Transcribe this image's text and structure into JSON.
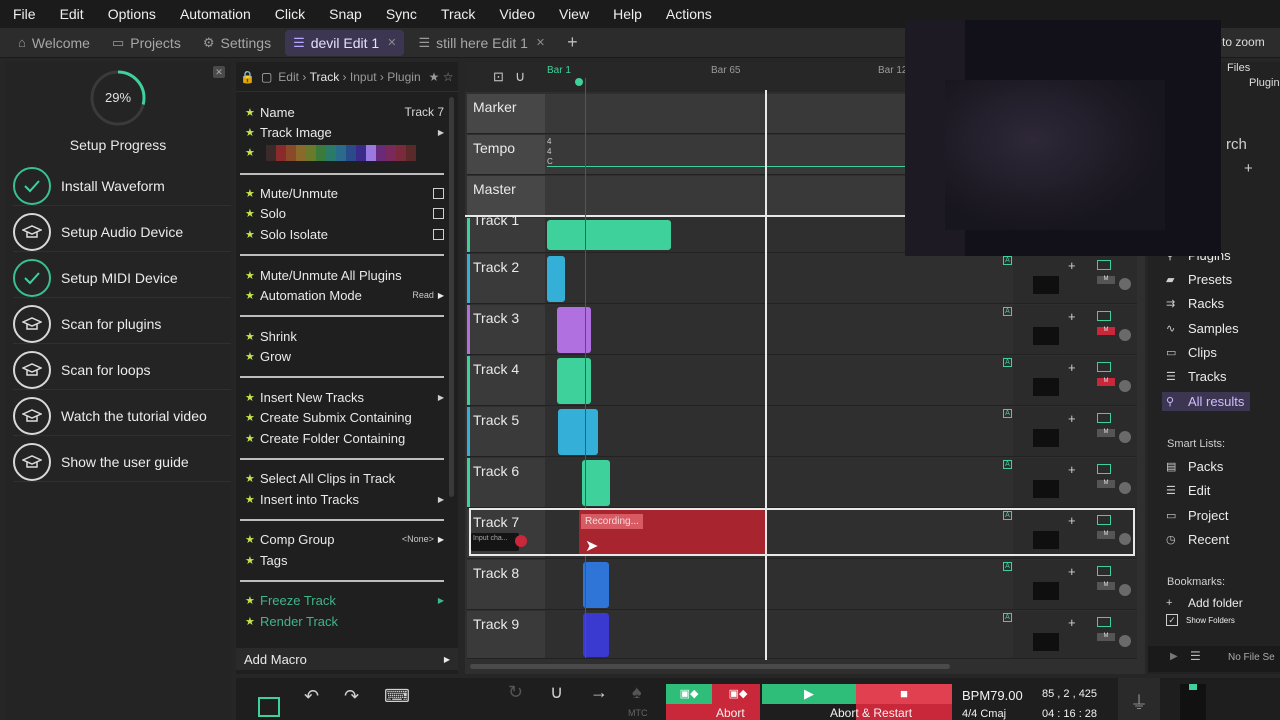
{
  "menu": [
    "File",
    "Edit",
    "Options",
    "Automation",
    "Click",
    "Snap",
    "Sync",
    "Track",
    "Video",
    "View",
    "Help",
    "Actions"
  ],
  "tabs": [
    {
      "label": "Welcome",
      "icon": "home-icon",
      "active": false
    },
    {
      "label": "Projects",
      "icon": "folder-icon",
      "active": false
    },
    {
      "label": "Settings",
      "icon": "gear-icon",
      "active": false
    },
    {
      "label": "devil Edit 1",
      "icon": "edit-icon",
      "active": true
    },
    {
      "label": "still here Edit 1",
      "icon": "edit-icon",
      "active": false
    }
  ],
  "setup": {
    "progress_label": "29%",
    "progress": 0.29,
    "title": "Setup Progress",
    "items": [
      {
        "label": "Install Waveform",
        "done": true
      },
      {
        "label": "Setup Audio Device",
        "done": false
      },
      {
        "label": "Setup MIDI Device",
        "done": true
      },
      {
        "label": "Scan for plugins",
        "done": false
      },
      {
        "label": "Scan for loops",
        "done": false
      },
      {
        "label": "Watch the tutorial video",
        "done": false
      },
      {
        "label": "Show the user guide",
        "done": false
      }
    ]
  },
  "props": {
    "breadcrumb": [
      "Edit",
      "Track",
      "Input",
      "Plugin"
    ],
    "name_label": "Name",
    "name_value": "Track 7",
    "track_image": "Track Image",
    "mute": "Mute/Unmute",
    "solo": "Solo",
    "solo_isolate": "Solo Isolate",
    "mute_all": "Mute/Unmute All Plugins",
    "automation_mode": "Automation Mode",
    "automation_value": "Read",
    "shrink": "Shrink",
    "grow": "Grow",
    "insert_new": "Insert New Tracks",
    "create_submix": "Create Submix Containing",
    "create_folder": "Create Folder Containing",
    "select_all_clips": "Select All Clips in Track",
    "insert_into": "Insert into Tracks",
    "comp_group": "Comp Group",
    "comp_value": "<None>",
    "tags": "Tags",
    "freeze": "Freeze Track",
    "render": "Render Track",
    "add_macro": "Add Macro"
  },
  "timeline": {
    "ruler": [
      "Bar 1",
      "Bar 65",
      "Bar 12"
    ],
    "meta_tracks": [
      "Marker",
      "Tempo",
      "Master"
    ],
    "tempo_sig": [
      "4",
      "4",
      "C"
    ],
    "tracks": [
      {
        "name": "Track 1",
        "color": "#3fd19b"
      },
      {
        "name": "Track 2",
        "color": "#34b0d8"
      },
      {
        "name": "Track 3",
        "color": "#b070e0"
      },
      {
        "name": "Track 4",
        "color": "#3fd19b"
      },
      {
        "name": "Track 5",
        "color": "#34b0d8"
      },
      {
        "name": "Track 6",
        "color": "#3fd19b"
      },
      {
        "name": "Track 7",
        "color": "#b070e0"
      },
      {
        "name": "Track 8",
        "color": "#2f75d8"
      },
      {
        "name": "Track 9",
        "color": "#3a3ad0"
      }
    ],
    "recording_label": "Recording...",
    "input_chip": "Input cha..."
  },
  "topright": {
    "zoom_text": "to zoom",
    "files": "Files",
    "plugin": "Plugin"
  },
  "browser": {
    "search_hint": "rch",
    "items": [
      {
        "label": "Plugins",
        "icon": "plug-icon"
      },
      {
        "label": "Presets",
        "icon": "tag-icon"
      },
      {
        "label": "Racks",
        "icon": "rack-icon"
      },
      {
        "label": "Samples",
        "icon": "wave-icon"
      },
      {
        "label": "Clips",
        "icon": "clips-icon"
      },
      {
        "label": "Tracks",
        "icon": "tracks-icon"
      },
      {
        "label": "All results",
        "icon": "search-icon"
      }
    ],
    "smart_lists_label": "Smart Lists:",
    "smart_lists": [
      {
        "label": "Packs",
        "icon": "pack-icon"
      },
      {
        "label": "Edit",
        "icon": "edit-icon"
      },
      {
        "label": "Project",
        "icon": "folder-icon"
      },
      {
        "label": "Recent",
        "icon": "clock-icon"
      }
    ],
    "bookmarks_label": "Bookmarks:",
    "add_folder": "Add folder",
    "show_folders": "Show Folders",
    "no_file": "No File Se"
  },
  "transport": {
    "abort": "Abort",
    "abort_restart": "Abort & Restart",
    "bpm": "BPM79.00",
    "position": "85 , 2 , 425",
    "timesig": "4/4  Cmaj",
    "time": "04 : 16 : 28",
    "mtc": "MTC"
  },
  "colors": {
    "accent": "#3fd19b",
    "record": "#c8283a",
    "tab_active": "#3d3652"
  }
}
